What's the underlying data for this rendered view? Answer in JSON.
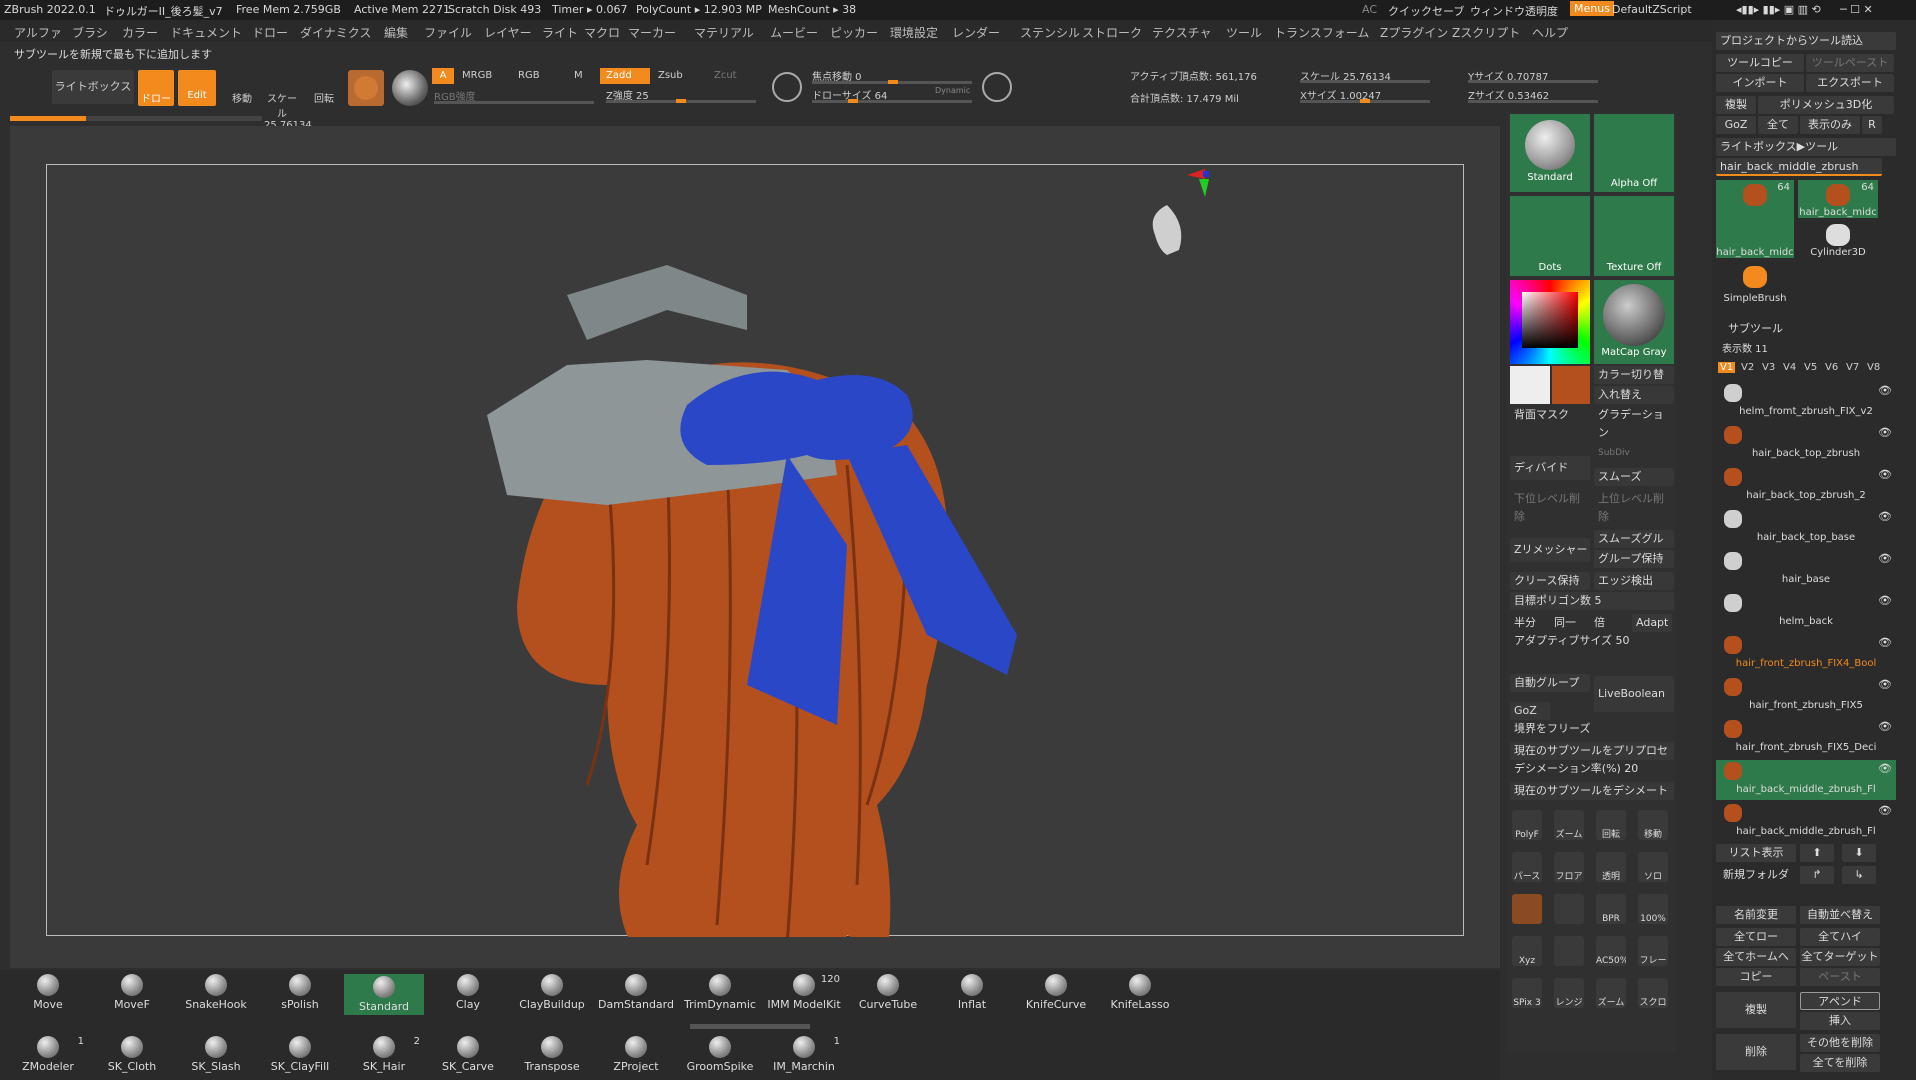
{
  "titlebar": {
    "app": "ZBrush 2022.0.1",
    "doc": "ドゥルガーII_後ろ髪_v7",
    "free_mem": "Free Mem 2.759GB",
    "active_mem": "Active Mem 2271",
    "scratch": "Scratch Disk 493",
    "timer": "Timer ▸ 0.067",
    "polycount": "PolyCount ▸ 12.903 MP",
    "meshcount": "MeshCount ▸ 38",
    "ac": "AC",
    "quicksave": "クイックセーブ",
    "transparency": "ウィンドウ透明度",
    "menus": "Menus",
    "script": "DefaultZScript"
  },
  "menu": [
    "アルファ",
    "ブラシ",
    "カラー",
    "ドキュメント",
    "ドロー",
    "ダイナミクス",
    "編集",
    "ファイル",
    "レイヤー",
    "ライト",
    "マクロ",
    "マーカー",
    "マテリアル",
    "ムービー",
    "ピッカー",
    "環境設定",
    "レンダー",
    "ステンシル",
    "ストローク",
    "テクスチャ",
    "ツール",
    "トランスフォーム",
    "Zプラグイン",
    "Zスクリプト",
    "ヘルプ"
  ],
  "notice": "サブツールを新規で最も下に追加します",
  "toolbar": {
    "lightbox": "ライトボックス",
    "draw": "ドロー",
    "edit": "Edit",
    "move": "移動",
    "scale": "スケール 25.76134",
    "rotate": "回転",
    "a": "A",
    "mrgb": "MRGB",
    "rgb": "RGB",
    "m": "M",
    "rgb_intensity": "RGB強度",
    "zadd": "Zadd",
    "zsub": "Zsub",
    "zcut": "Zcut",
    "z_intensity": "Z強度 25",
    "focal": "焦点移動 0",
    "draw_size": "ドローサイズ 64",
    "dynamic": "Dynamic",
    "active_points": "アクティブ頂点数: 561,176",
    "total_points": "合計頂点数: 17.479 Mil",
    "xsize": "Xサイズ 1.00247",
    "ysize": "Yサイズ 0.70787",
    "zsize": "Zサイズ 0.53462",
    "progress": 0.3
  },
  "midpanel": {
    "standard": "Standard",
    "alpha_off": "Alpha Off",
    "dots": "Dots",
    "texture_off": "Texture Off",
    "matcap": "MatCap Gray",
    "color_switch": "カラー切り替え",
    "swap": "入れ替え",
    "bg_mask": "背面マスク",
    "gradation": "グラデーション",
    "subdiv": "SubDiv",
    "divide": "ディバイド",
    "smooth": "スムーズ",
    "del_lower": "下位レベル削除",
    "del_higher": "上位レベル削除",
    "zremesher": "Zリメッシャー",
    "smooth_groups": "スムーズグルー",
    "keep_groups": "グループ保持",
    "keep_creases": "クリース保持",
    "detect_edges": "エッジ検出",
    "target_poly": "目標ポリゴン数 5",
    "half": "半分",
    "same": "同一",
    "double": "倍",
    "adapt": "Adapt",
    "adaptive_size": "アダプティブサイズ 50",
    "auto_groups": "自動グループ",
    "live_boolean": "LiveBoolean",
    "goz": "GoZ",
    "freeze_borders": "境界をフリーズ",
    "preprocess": "現在のサブツールをプリプロセ",
    "decimation": "デシメーション率(%) 20",
    "decimate": "現在のサブツールをデシメート",
    "icons": [
      "PolyF",
      "ズーム3D",
      "回転",
      "移動",
      "パース",
      "フロア",
      "透明",
      "ソロ",
      "",
      "",
      "BPR",
      "100%",
      "Xyz",
      "",
      "AC50%",
      "フレーム",
      "SPix 3",
      "レンジパッド",
      "ズーム2D",
      "スクロール"
    ]
  },
  "rightpanel": {
    "project_load": "プロジェクトからツール読込",
    "tool_copy": "ツールコピー",
    "tool_paste": "ツールペースト",
    "import": "インポート",
    "export": "エクスポート",
    "duplicate": "複製",
    "polymesh3d": "ポリメッシュ3D化",
    "goz": "GoZ",
    "all": "全て",
    "visible": "表示のみ",
    "r": "R",
    "lightbox_tool": "ライトボックス▶ツール",
    "current_tool": "hair_back_middle_zbrush",
    "thumbs": [
      {
        "label": "hair_back_midc",
        "count": "64"
      },
      {
        "label": "hair_back_midc",
        "count": "64"
      },
      {
        "label": "Cylinder3D",
        "count": ""
      },
      {
        "label": "SimpleBrush",
        "count": ""
      }
    ],
    "subtool_header": "サブツール",
    "display_count": "表示数 11",
    "versions": [
      "V1",
      "V2",
      "V3",
      "V4",
      "V5",
      "V6",
      "V7",
      "V8"
    ],
    "subtools": [
      "helm_fromt_zbrush_FIX_v2",
      "hair_back_top_zbrush",
      "hair_back_top_zbrush_2",
      "hair_back_top_base",
      "hair_base",
      "helm_back",
      "hair_front_zbrush_FIX4_Bool",
      "hair_front_zbrush_FIX5",
      "hair_front_zbrush_FIX5_Deci",
      "hair_back_middle_zbrush_Fl",
      "hair_back_middle_zbrush_Fl"
    ],
    "list_view": "リスト表示",
    "new_folder": "新規フォルダ",
    "rename": "名前変更",
    "auto_sort": "自動並べ替え",
    "all_low": "全てロー",
    "all_high": "全てハイ",
    "all_home": "全てホームへ",
    "all_target": "全てターゲット",
    "copy": "コピー",
    "paste": "ペースト",
    "dup": "複製",
    "append": "アペンド",
    "insert": "挿入",
    "delete": "削除",
    "delete_others": "その他を削除",
    "delete_all": "全てを削除"
  },
  "brushes_row1": [
    {
      "label": "Move",
      "count": ""
    },
    {
      "label": "MoveF",
      "count": ""
    },
    {
      "label": "SnakeHook",
      "count": ""
    },
    {
      "label": "sPolish",
      "count": ""
    },
    {
      "label": "Standard",
      "count": ""
    },
    {
      "label": "Clay",
      "count": ""
    },
    {
      "label": "ClayBuildup",
      "count": ""
    },
    {
      "label": "DamStandard",
      "count": ""
    },
    {
      "label": "TrimDynamic",
      "count": ""
    },
    {
      "label": "IMM ModelKit",
      "count": "120"
    },
    {
      "label": "CurveTube",
      "count": ""
    },
    {
      "label": "Inflat",
      "count": ""
    },
    {
      "label": "KnifeCurve",
      "count": ""
    },
    {
      "label": "KnifeLasso",
      "count": ""
    }
  ],
  "brushes_row2": [
    {
      "label": "ZModeler",
      "count": "1"
    },
    {
      "label": "SK_Cloth",
      "count": ""
    },
    {
      "label": "SK_Slash",
      "count": ""
    },
    {
      "label": "SK_ClayFill",
      "count": ""
    },
    {
      "label": "SK_Hair",
      "count": "2"
    },
    {
      "label": "SK_Carve",
      "count": ""
    },
    {
      "label": "Transpose",
      "count": ""
    },
    {
      "label": "ZProject",
      "count": ""
    },
    {
      "label": "GroomSpike",
      "count": ""
    },
    {
      "label": "IM_Marchin",
      "count": "1"
    }
  ],
  "colors": {
    "accent": "#f38a1d",
    "green": "#2f7a4a",
    "hair": "#b3501e",
    "ribbon": "#2a47c8",
    "helmet": "#8e9698"
  }
}
